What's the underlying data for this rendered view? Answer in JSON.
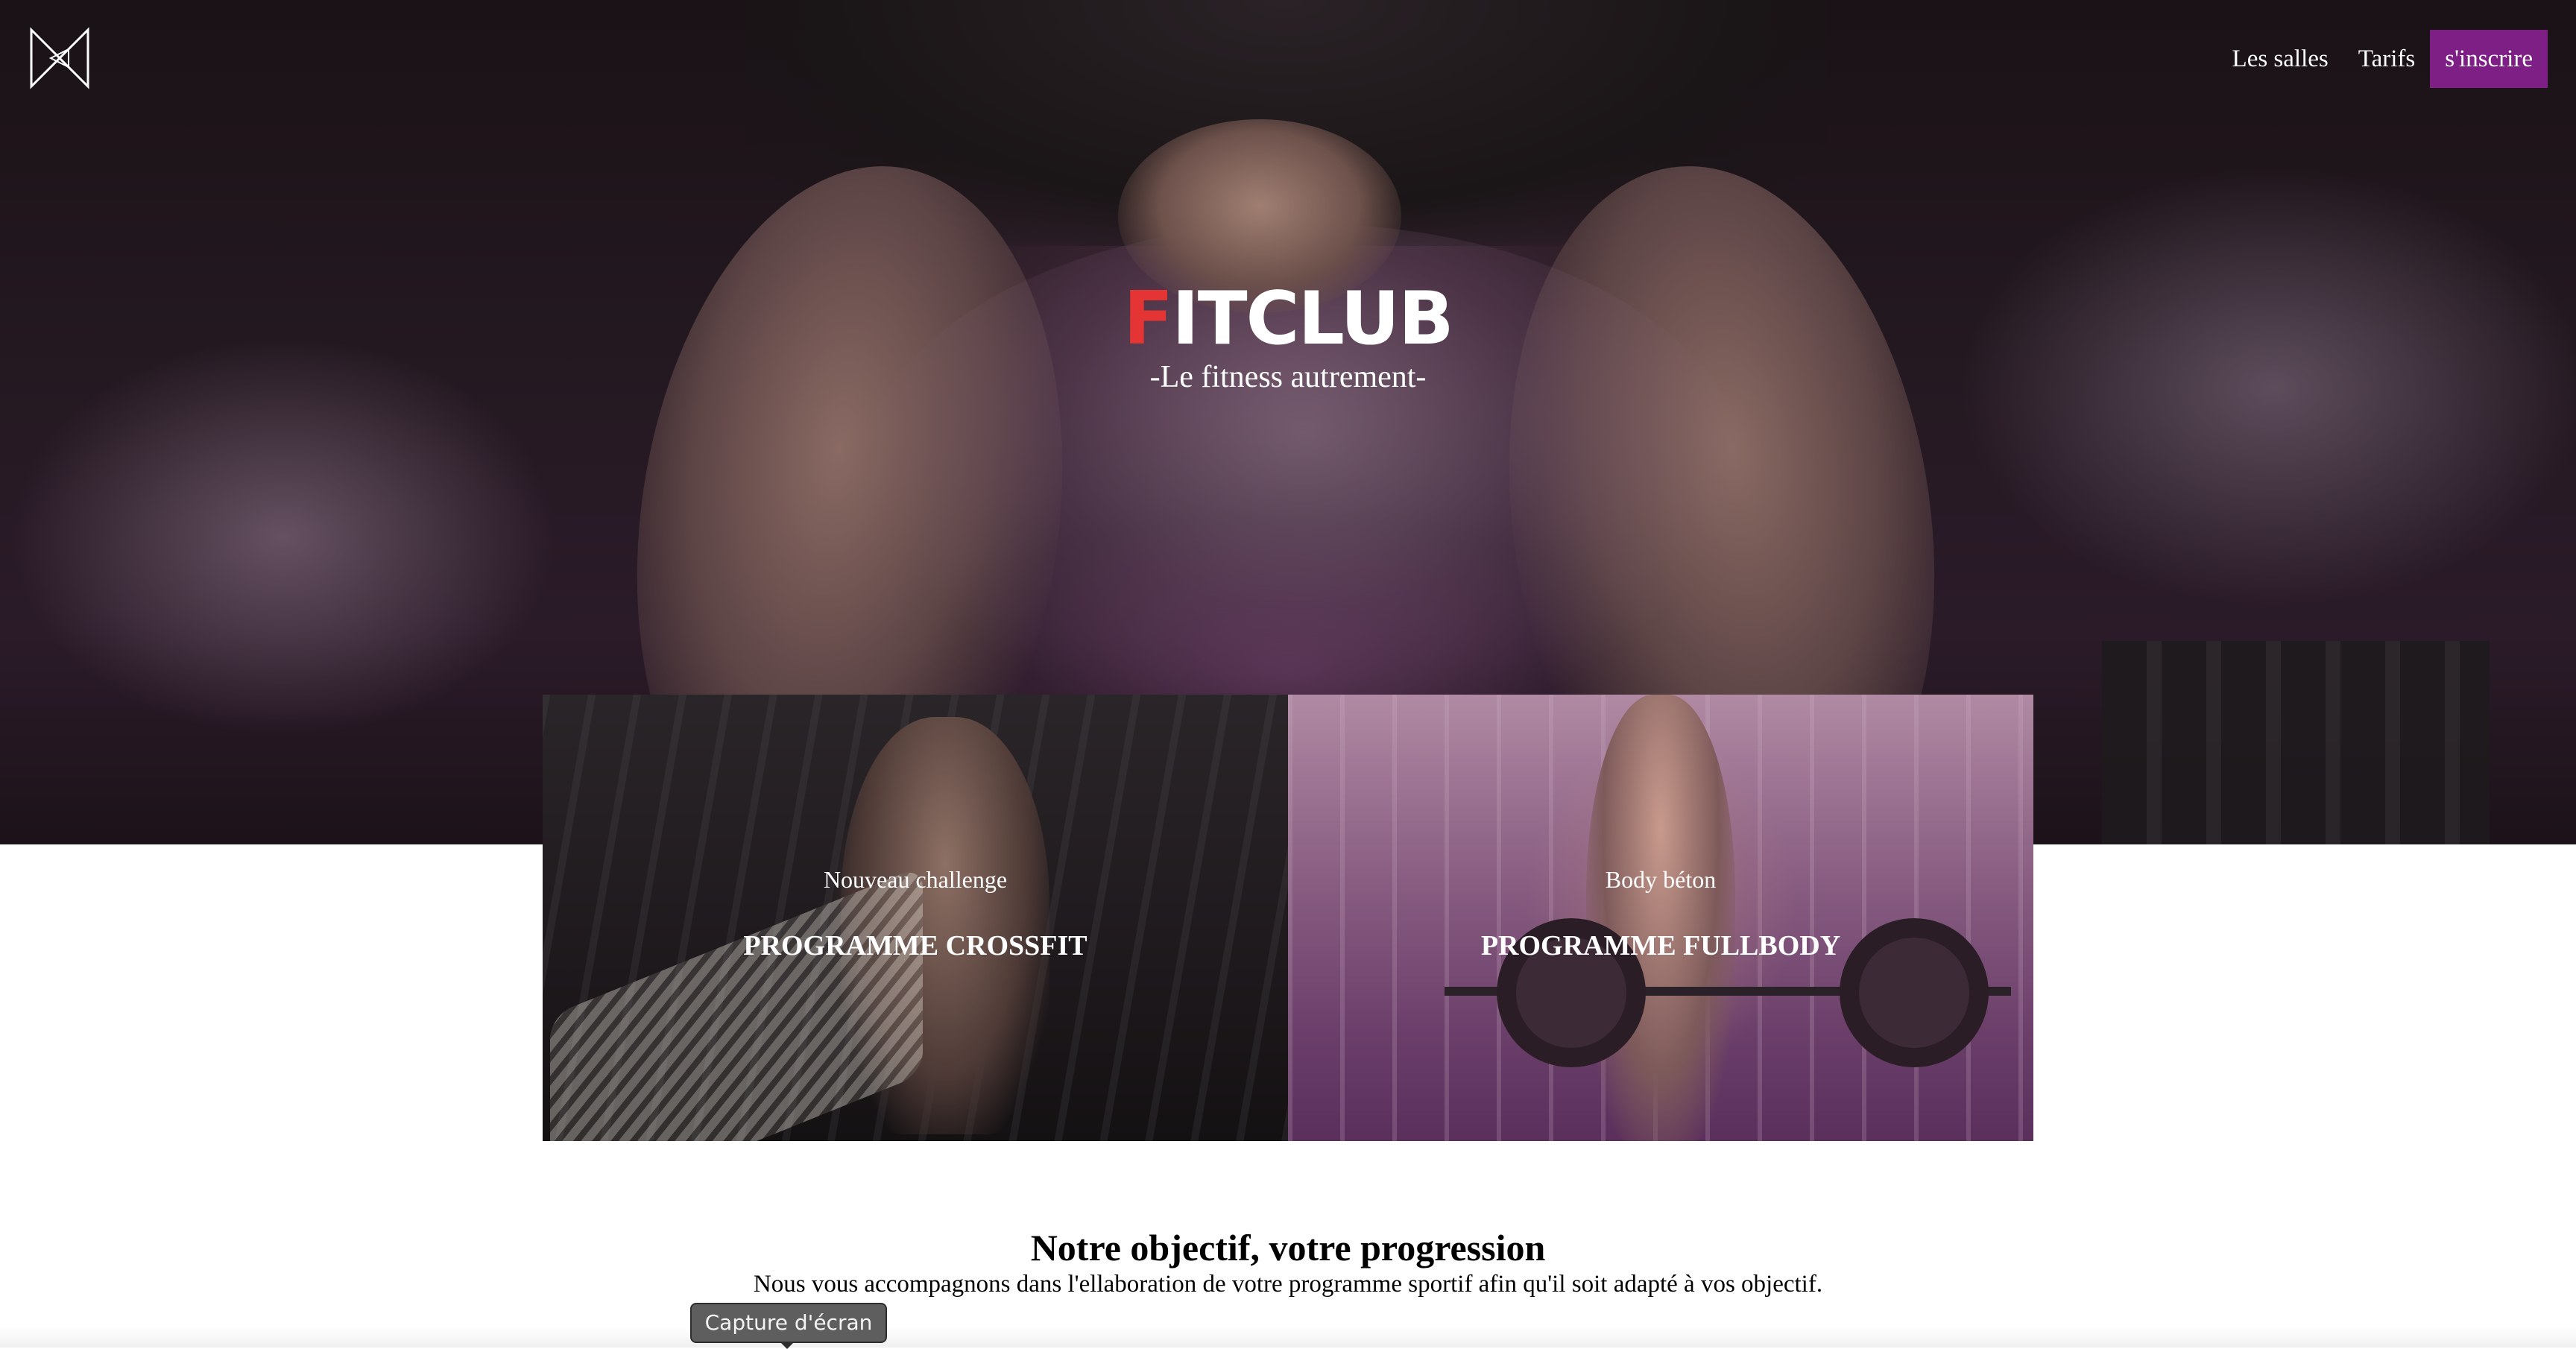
{
  "header": {
    "logo_icon": "bowtie-logo-icon",
    "nav": [
      {
        "label": "Les salles"
      },
      {
        "label": "Tarifs"
      }
    ],
    "cta_label": "s'inscrire",
    "cta_color": "#7e1f86"
  },
  "hero": {
    "brand_first_letter": "F",
    "brand_rest": "ITCLUB",
    "brand_accent_color": "#e53434",
    "tagline": "-Le fitness autrement-"
  },
  "programs": [
    {
      "subtitle": "Nouveau challenge",
      "title": "PROGRAMME CROSSFIT"
    },
    {
      "subtitle": "Body béton",
      "title": "PROGRAMME FULLBODY"
    }
  ],
  "objective": {
    "title": "Notre objectif, votre progression",
    "text": "Nous vous accompagnons dans l'ellaboration de votre programme sportif afin qu'il soit adapté à vos objectif."
  },
  "tooltip": {
    "label": "Capture d'écran"
  }
}
